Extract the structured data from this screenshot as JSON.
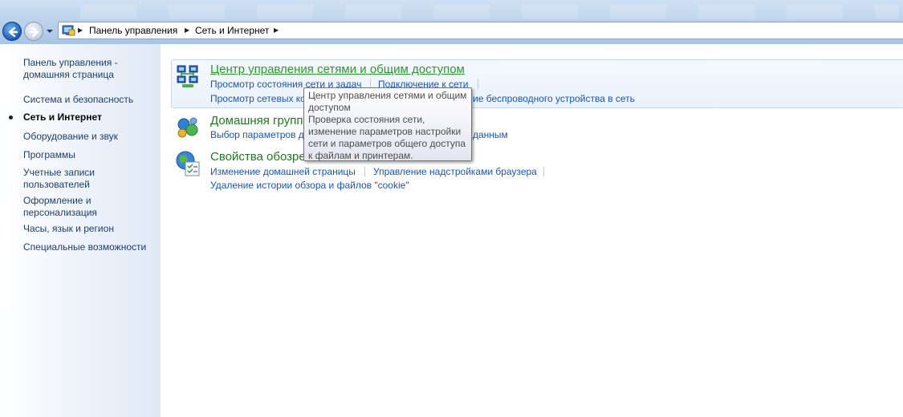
{
  "address_bar": {
    "crumbs": [
      "Панель управления",
      "Сеть и Интернет"
    ]
  },
  "sidebar": {
    "items": [
      {
        "label_line1": "Панель управления -",
        "label_line2": "домашняя страница"
      },
      {
        "label": "Система и безопасность"
      },
      {
        "label": "Сеть и Интернет",
        "active": true
      },
      {
        "label": "Оборудование и звук"
      },
      {
        "label": "Программы"
      },
      {
        "label_line1": "Учетные записи",
        "label_line2": "пользователей"
      },
      {
        "label_line1": "Оформление и",
        "label_line2": "персонализация"
      },
      {
        "label": "Часы, язык и регион"
      },
      {
        "label": "Специальные возможности"
      }
    ]
  },
  "categories": [
    {
      "title": "Центр управления сетями и общим доступом",
      "icon": "network-center-icon",
      "links": [
        "Просмотр состояния сети и задач",
        "Подключение к сети",
        "Просмотр сетевых компьютеров и устройств",
        "Добавление беспроводного устройства в сеть"
      ],
      "visible_links": [
        "Просмотр состояния сети и задач",
        "Подключение к сети",
        "Просмотр сетевых ко",
        "ие беспроводного устройства в сеть"
      ]
    },
    {
      "title": "Домашняя групп",
      "icon": "homegroup-icon",
      "visible_links": [
        "Выбор параметров д",
        "данным"
      ]
    },
    {
      "title": "Свойства обозре",
      "icon": "internet-options-icon",
      "links": [
        "Изменение домашней страницы",
        "Управление надстройками браузера",
        "Удаление истории обзора и файлов \"cookie\""
      ]
    }
  ],
  "tooltip": {
    "lines": [
      "Центр управления сетями и общим",
      "доступом",
      "Проверка состояния сети,",
      "изменение параметров настройки",
      "сети и параметров общего доступа",
      "к файлам и принтерам."
    ]
  },
  "colors": {
    "category_title": "#1e7a1e",
    "link": "#1a55b5",
    "sidebar_text": "#1e3d6b"
  }
}
